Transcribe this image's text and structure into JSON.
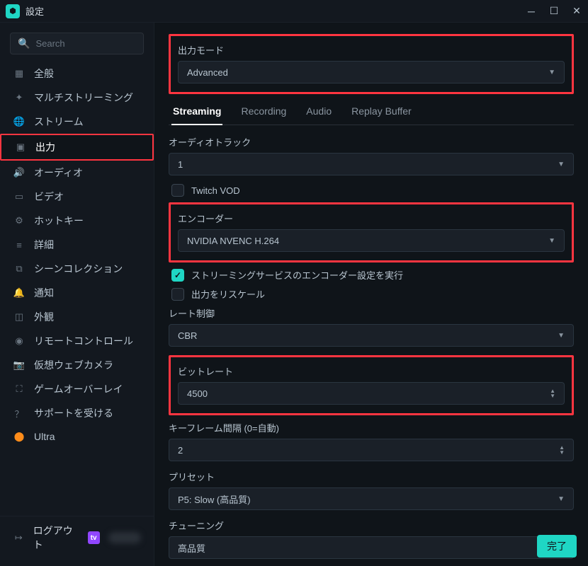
{
  "titlebar": {
    "title": "設定"
  },
  "search": {
    "placeholder": "Search"
  },
  "sidebar": {
    "items": [
      {
        "icon": "grid",
        "label": "全般"
      },
      {
        "icon": "star",
        "label": "マルチストリーミング"
      },
      {
        "icon": "globe",
        "label": "ストリーム"
      },
      {
        "icon": "output",
        "label": "出力"
      },
      {
        "icon": "audio",
        "label": "オーディオ"
      },
      {
        "icon": "video",
        "label": "ビデオ"
      },
      {
        "icon": "gear",
        "label": "ホットキー"
      },
      {
        "icon": "list",
        "label": "詳細"
      },
      {
        "icon": "scene",
        "label": "シーンコレクション"
      },
      {
        "icon": "bell",
        "label": "通知"
      },
      {
        "icon": "appearance",
        "label": "外観"
      },
      {
        "icon": "remote",
        "label": "リモートコントロール"
      },
      {
        "icon": "camera",
        "label": "仮想ウェブカメラ"
      },
      {
        "icon": "overlay",
        "label": "ゲームオーバーレイ"
      },
      {
        "icon": "help",
        "label": "サポートを受ける"
      },
      {
        "icon": "ultra",
        "label": "Ultra"
      }
    ],
    "logout": "ログアウト"
  },
  "output_mode": {
    "label": "出力モード",
    "value": "Advanced"
  },
  "tabs": [
    {
      "label": "Streaming",
      "active": true
    },
    {
      "label": "Recording"
    },
    {
      "label": "Audio"
    },
    {
      "label": "Replay Buffer"
    }
  ],
  "audio_track": {
    "label": "オーディオトラック",
    "value": "1"
  },
  "twitch_vod": {
    "label": "Twitch VOD",
    "checked": false
  },
  "encoder": {
    "label": "エンコーダー",
    "value": "NVIDIA NVENC H.264"
  },
  "enforce_encoder": {
    "label": "ストリーミングサービスのエンコーダー設定を実行",
    "checked": true
  },
  "rescale": {
    "label": "出力をリスケール",
    "checked": false
  },
  "rate_control": {
    "label": "レート制御",
    "value": "CBR"
  },
  "bitrate": {
    "label": "ビットレート",
    "value": "4500"
  },
  "keyframe": {
    "label": "キーフレーム間隔 (0=自動)",
    "value": "2"
  },
  "preset": {
    "label": "プリセット",
    "value": "P5: Slow (高品質)"
  },
  "tuning": {
    "label": "チューニング",
    "value": "高品質"
  },
  "done_button": "完了"
}
